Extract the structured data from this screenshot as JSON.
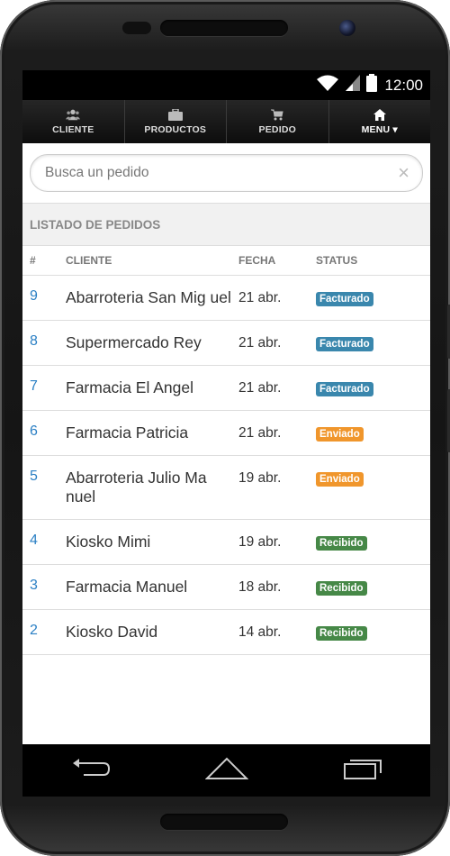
{
  "status_bar": {
    "time": "12:00"
  },
  "nav": [
    {
      "label": "CLIENTE",
      "icon": "users-icon"
    },
    {
      "label": "PRODUCTOS",
      "icon": "briefcase-icon"
    },
    {
      "label": "PEDIDO",
      "icon": "cart-icon"
    },
    {
      "label": "MENU",
      "icon": "home-icon"
    }
  ],
  "search": {
    "placeholder": "Busca un pedido",
    "value": ""
  },
  "section_title": "LISTADO DE PEDIDOS",
  "table": {
    "headers": [
      "#",
      "CLIENTE",
      "FECHA",
      "STATUS"
    ],
    "rows": [
      {
        "num": "9",
        "cliente": "Abarroteria San Mig uel",
        "fecha": "21 abr.",
        "status": "Facturado"
      },
      {
        "num": "8",
        "cliente": "Supermercado Rey",
        "fecha": "21 abr.",
        "status": "Facturado"
      },
      {
        "num": "7",
        "cliente": "Farmacia El Angel",
        "fecha": "21 abr.",
        "status": "Facturado"
      },
      {
        "num": "6",
        "cliente": "Farmacia Patricia",
        "fecha": "21 abr.",
        "status": "Enviado"
      },
      {
        "num": "5",
        "cliente": "Abarroteria Julio Ma nuel",
        "fecha": "19 abr.",
        "status": "Enviado"
      },
      {
        "num": "4",
        "cliente": "Kiosko Mimi",
        "fecha": "19 abr.",
        "status": "Recibido"
      },
      {
        "num": "3",
        "cliente": "Farmacia Manuel",
        "fecha": "18 abr.",
        "status": "Recibido"
      },
      {
        "num": "2",
        "cliente": "Kiosko David",
        "fecha": "14 abr.",
        "status": "Recibido"
      }
    ]
  },
  "status_colors": {
    "Facturado": "#3a87ad",
    "Enviado": "#f0962c",
    "Recibido": "#468847"
  }
}
